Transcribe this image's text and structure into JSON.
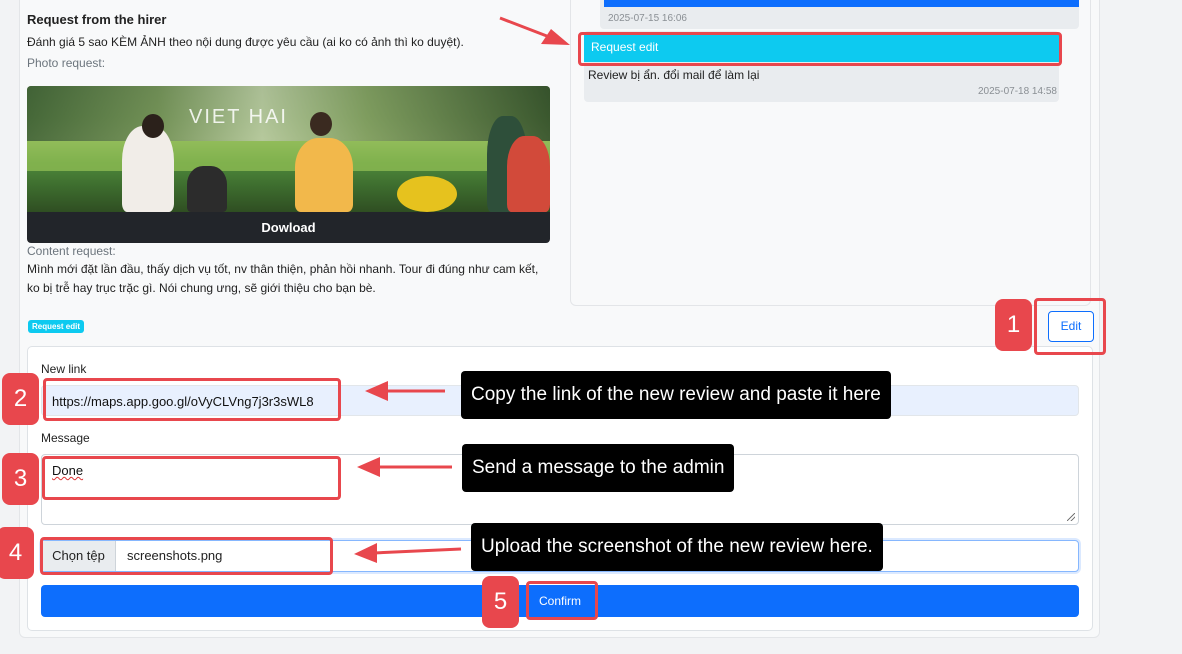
{
  "request": {
    "title": "Request from the hirer",
    "text": "Đánh giá 5 sao KÈM ẢNH theo nội dung được yêu cầu (ai ko có ảnh thì ko duyệt).",
    "photo_label": "Photo request:",
    "photo_logo": "VIET HAI",
    "download_label": "Dowload",
    "content_label": "Content request:",
    "content_text": "Mình mới đặt lần đầu, thấy dịch vụ tốt, nv thân thiện, phản hồi nhanh. Tour đi đúng như cam kết, ko bị trễ hay trục trặc gì. Nói chung ưng, sẽ giới thiệu cho bạn bè."
  },
  "chat": {
    "message1_time": "2025-07-15 16:06",
    "message2_header": "Request edit",
    "message2_text": "Review bị ẩn. đổi mail để làm lại",
    "message2_time": "2025-07-18 14:58"
  },
  "status_badge": "Request edit",
  "edit_button": "Edit",
  "form": {
    "link_label": "New link",
    "link_value": "https://maps.app.goo.gl/oVyCLVng7j3r3sWL8",
    "message_label": "Message",
    "message_value": "Done",
    "file_button": "Chọn tệp",
    "file_name": "screenshots.png",
    "confirm_label": "Confirm"
  },
  "annotations": {
    "step1": "1",
    "step2": "2",
    "step3": "3",
    "step4": "4",
    "step5": "5",
    "tip2": "Copy the link of the new review and paste it here",
    "tip3": "Send a message to the admin",
    "tip4": "Upload the screenshot of the new review here.",
    "highlight_color": "#e8474d"
  }
}
